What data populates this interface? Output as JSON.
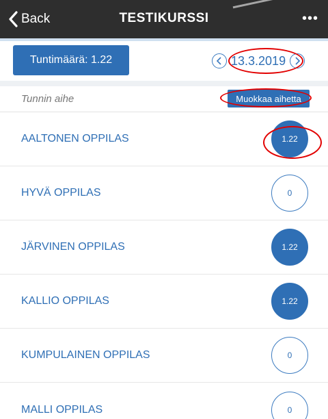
{
  "nav": {
    "back_label": "Back",
    "title": "TESTIKURSSI",
    "more_label": "•••"
  },
  "toolbar": {
    "hours_button_label": "Tuntimäärä: 1.22",
    "date": "13.3.2019"
  },
  "topic": {
    "label": "Tunnin aihe",
    "edit_button_label": "Muokkaa aihetta"
  },
  "students": [
    {
      "name": "AALTONEN OPPILAS",
      "hours": "1.22",
      "filled": true
    },
    {
      "name": "HYVÄ OPPILAS",
      "hours": "0",
      "filled": false
    },
    {
      "name": "JÄRVINEN OPPILAS",
      "hours": "1.22",
      "filled": true
    },
    {
      "name": "KALLIO OPPILAS",
      "hours": "1.22",
      "filled": true
    },
    {
      "name": "KUMPULAINEN OPPILAS",
      "hours": "0",
      "filled": false
    },
    {
      "name": "MALLI OPPILAS",
      "hours": "0",
      "filled": false
    }
  ],
  "colors": {
    "navbar": "#2e2e2e",
    "accent": "#2f6fb5",
    "annotation": "#e20000"
  }
}
